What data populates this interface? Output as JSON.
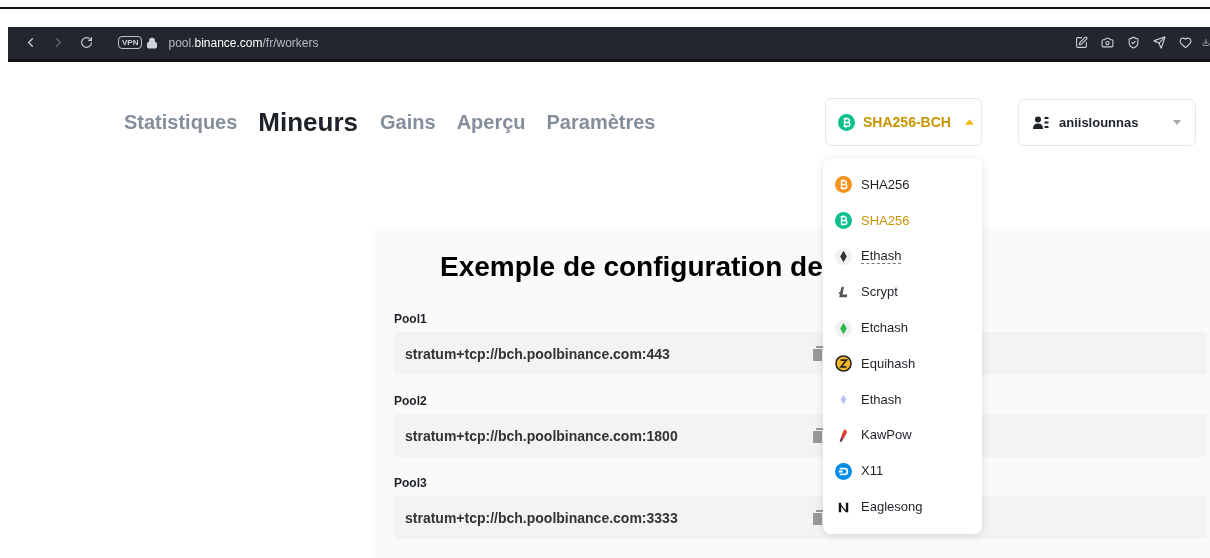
{
  "browser": {
    "vpn": "VPN",
    "url": "pool.**binance.com**/fr/workers"
  },
  "tabs": [
    {
      "label": "Statistiques",
      "selected": false
    },
    {
      "label": "Mineurs",
      "selected": true
    },
    {
      "label": "Gains",
      "selected": false
    },
    {
      "label": "Aperçu",
      "selected": false
    },
    {
      "label": "Paramètres",
      "selected": false
    }
  ],
  "algo_select": {
    "label": "SHA256-BCH",
    "expanded": true
  },
  "account": {
    "name": "aniislounnas"
  },
  "algo_menu": [
    {
      "label": "SHA256",
      "kind": "btc",
      "selected": false,
      "underlined": false
    },
    {
      "label": "SHA256",
      "kind": "bch",
      "selected": true,
      "underlined": false
    },
    {
      "label": "Ethash",
      "kind": "eth",
      "selected": false,
      "underlined": true
    },
    {
      "label": "Scrypt",
      "kind": "ltc",
      "selected": false,
      "underlined": false
    },
    {
      "label": "Etchash",
      "kind": "etc",
      "selected": false,
      "underlined": false
    },
    {
      "label": "Equihash",
      "kind": "zec",
      "selected": false,
      "underlined": false
    },
    {
      "label": "Ethash",
      "kind": "ethw",
      "selected": false,
      "underlined": false
    },
    {
      "label": "KawPow",
      "kind": "rvn",
      "selected": false,
      "underlined": false
    },
    {
      "label": "X11",
      "kind": "dash",
      "selected": false,
      "underlined": false
    },
    {
      "label": "Eaglesong",
      "kind": "ckb",
      "selected": false,
      "underlined": false
    }
  ],
  "config": {
    "title": "Exemple de configuration de",
    "pools": [
      {
        "label": "Pool1",
        "value": "stratum+tcp://bch.poolbinance.com:443"
      },
      {
        "label": "Pool2",
        "value": "stratum+tcp://bch.poolbinance.com:1800"
      },
      {
        "label": "Pool3",
        "value": "stratum+tcp://bch.poolbinance.com:3333"
      }
    ]
  }
}
